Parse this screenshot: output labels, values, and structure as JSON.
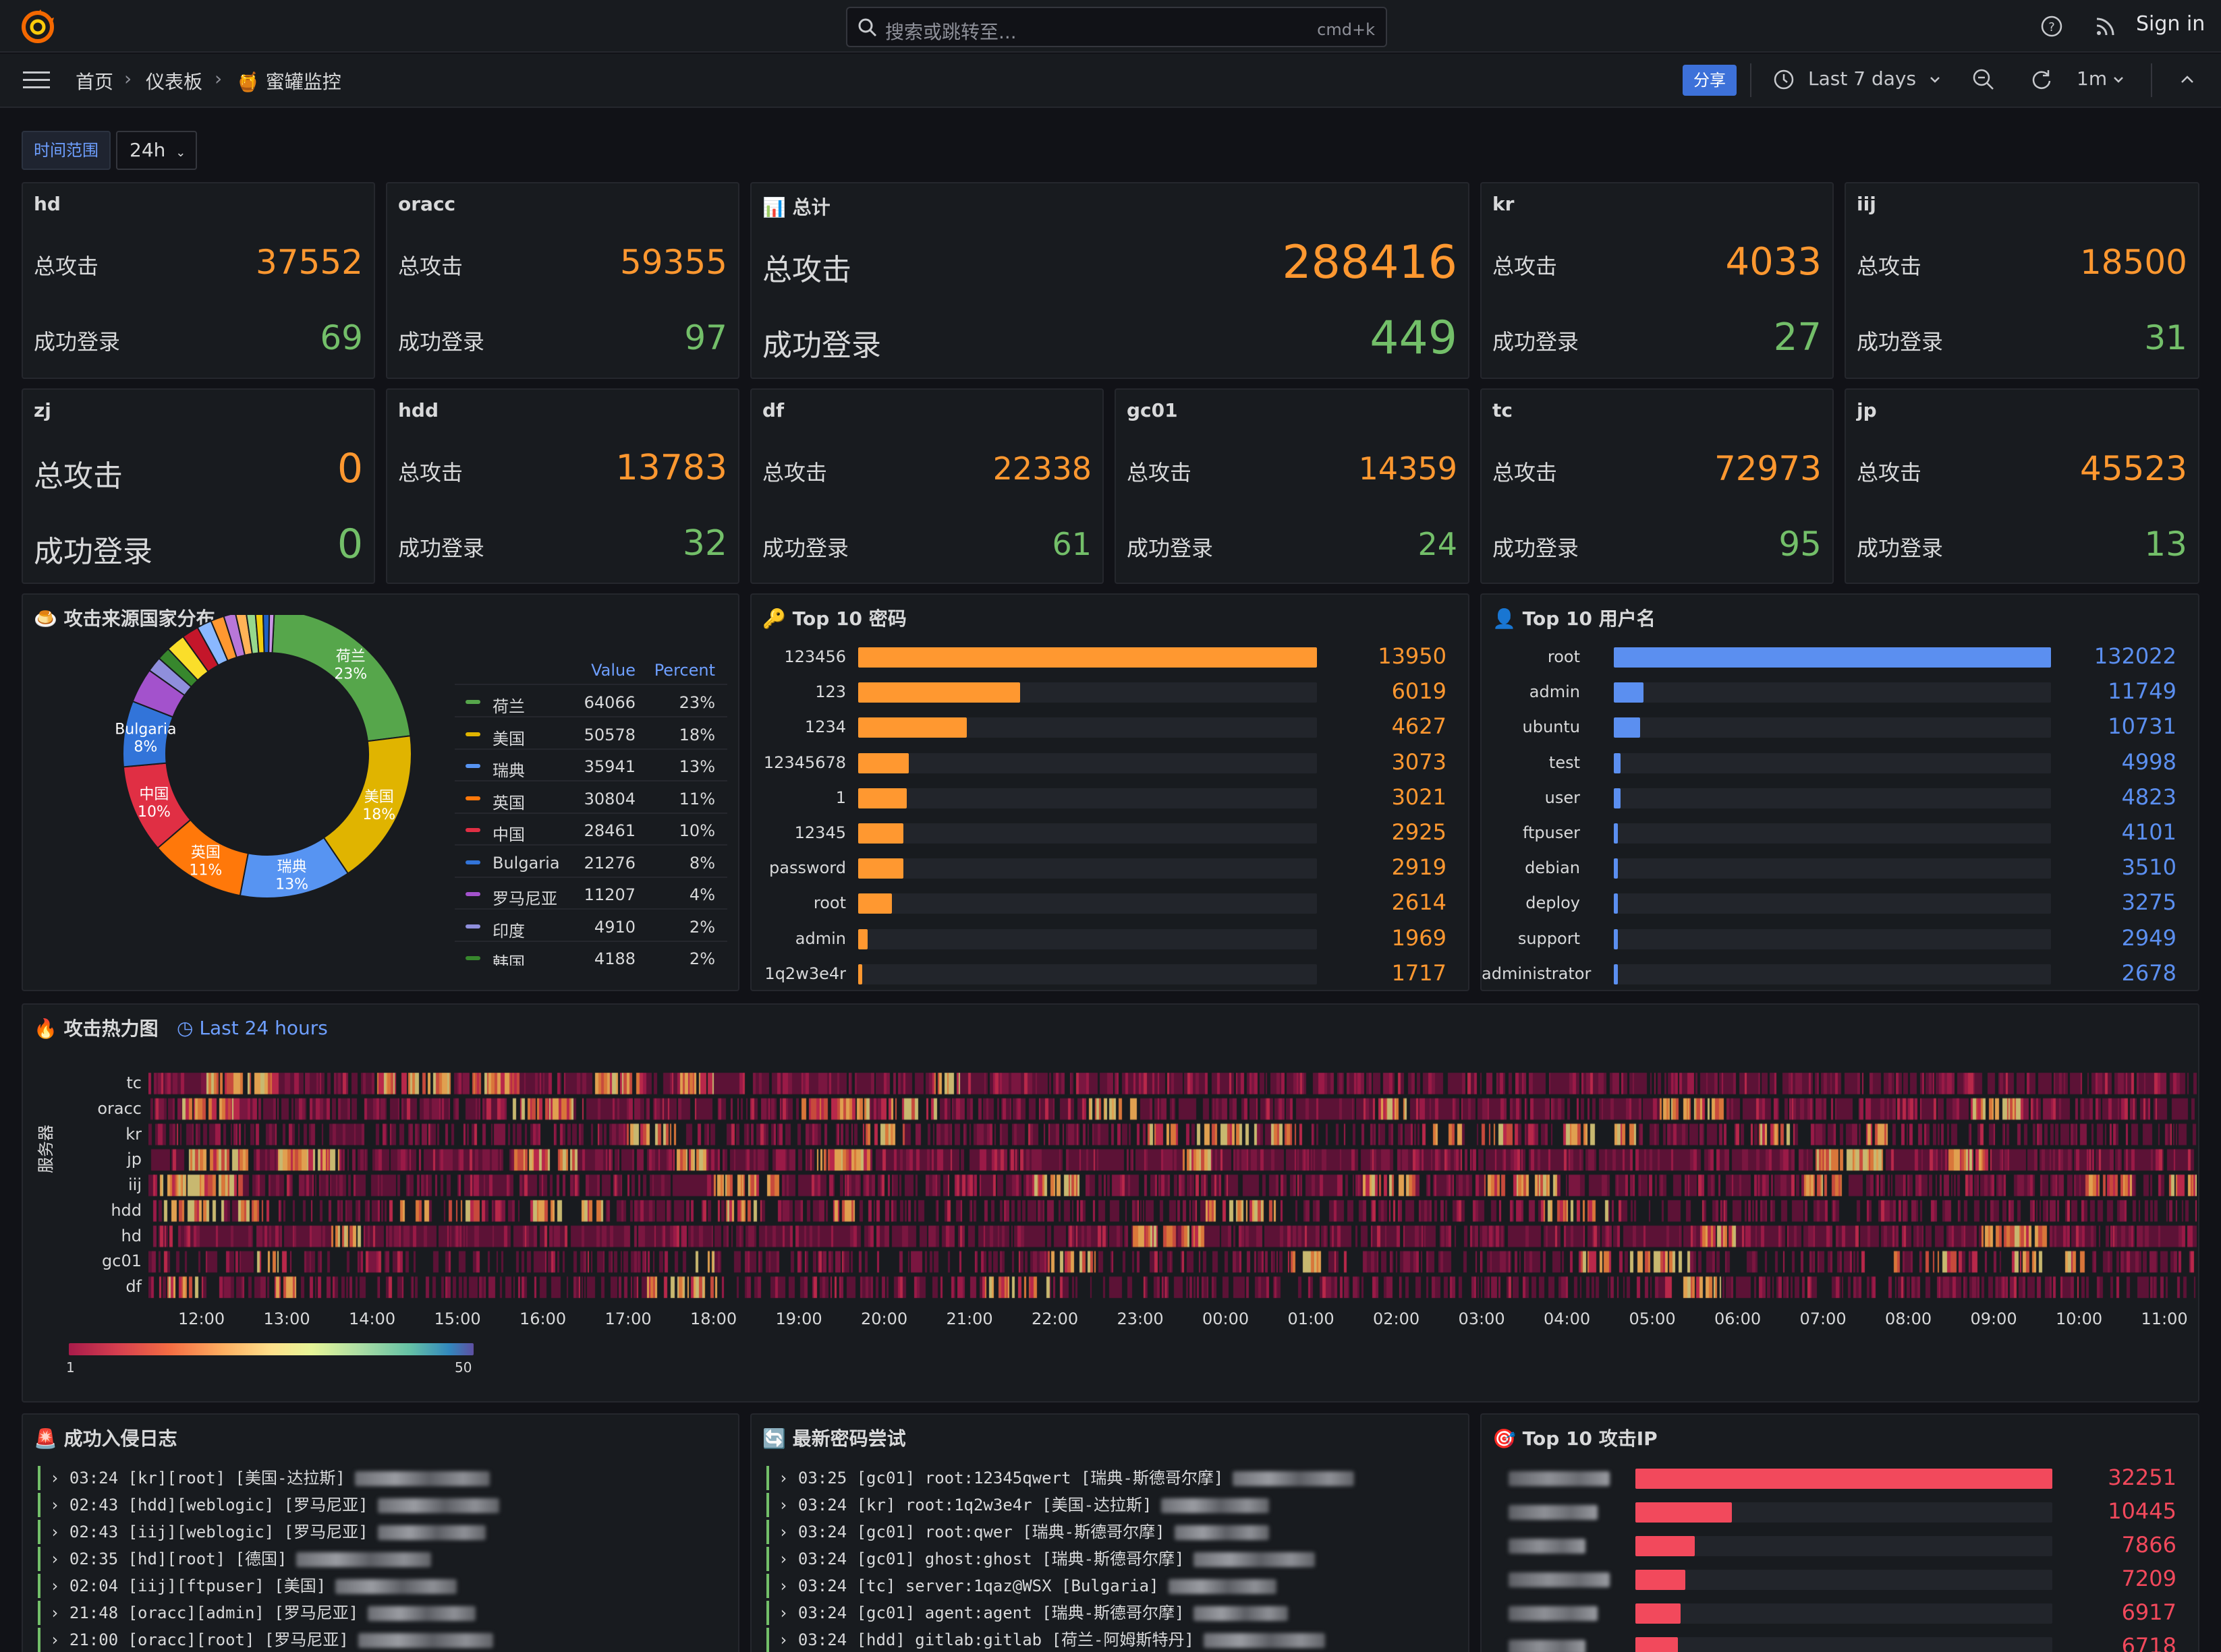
{
  "search": {
    "placeholder": "搜索或跳转至...",
    "shortcut": "cmd+k"
  },
  "header": {
    "sign_in": "Sign in"
  },
  "breadcrumb": {
    "home": "首页",
    "dashboards": "仪表板",
    "current": "🍯 蜜罐监控"
  },
  "nav": {
    "share": "分享",
    "time_range": "Last 7 days",
    "refresh_interval": "1m"
  },
  "filters": {
    "label": "时间范围",
    "value": "24h"
  },
  "stats_labels": {
    "attacks": "总攻击",
    "logins": "成功登录"
  },
  "stat_panels": [
    {
      "name": "hd",
      "attacks": "37552",
      "logins": "69"
    },
    {
      "name": "oracc",
      "attacks": "59355",
      "logins": "97"
    },
    {
      "name": "📊 总计",
      "attacks": "288416",
      "logins": "449"
    },
    {
      "name": "kr",
      "attacks": "4033",
      "logins": "27"
    },
    {
      "name": "iij",
      "attacks": "18500",
      "logins": "31"
    },
    {
      "name": "zj",
      "attacks": "0",
      "logins": "0"
    },
    {
      "name": "hdd",
      "attacks": "13783",
      "logins": "32"
    },
    {
      "name": "df",
      "attacks": "22338",
      "logins": "61"
    },
    {
      "name": "gc01",
      "attacks": "14359",
      "logins": "24"
    },
    {
      "name": "tc",
      "attacks": "72973",
      "logins": "95"
    },
    {
      "name": "jp",
      "attacks": "45523",
      "logins": "13"
    }
  ],
  "country_panel": {
    "title": "🍮 攻击来源国家分布",
    "col_value": "Value",
    "col_percent": "Percent",
    "rows": [
      {
        "name": "荷兰",
        "value": "64066",
        "percent": "23%",
        "color": "#56a64b"
      },
      {
        "name": "美国",
        "value": "50578",
        "percent": "18%",
        "color": "#e0b400"
      },
      {
        "name": "瑞典",
        "value": "35941",
        "percent": "13%",
        "color": "#5794f2"
      },
      {
        "name": "英国",
        "value": "30804",
        "percent": "11%",
        "color": "#ff780a"
      },
      {
        "name": "中国",
        "value": "28461",
        "percent": "10%",
        "color": "#e02f44"
      },
      {
        "name": "Bulgaria",
        "value": "21276",
        "percent": "8%",
        "color": "#3274d9"
      },
      {
        "name": "罗马尼亚",
        "value": "11207",
        "percent": "4%",
        "color": "#a352cc"
      },
      {
        "name": "印度",
        "value": "4910",
        "percent": "2%",
        "color": "#8f8fdc"
      },
      {
        "name": "韩国",
        "value": "4188",
        "percent": "2%",
        "color": "#37872d"
      }
    ],
    "pie_labels": [
      {
        "name": "荷兰",
        "pct": "23%"
      },
      {
        "name": "美国",
        "pct": "18%"
      },
      {
        "name": "瑞典",
        "pct": "13%"
      },
      {
        "name": "英国",
        "pct": "11%"
      },
      {
        "name": "中国",
        "pct": "10%"
      },
      {
        "name": "Bulgaria",
        "pct": "8%"
      }
    ]
  },
  "password_panel": {
    "title": "🔑 Top 10 密码",
    "items": [
      {
        "label": "123456",
        "value": "13950",
        "frac": 1.0
      },
      {
        "label": "123",
        "value": "6019",
        "frac": 0.3535
      },
      {
        "label": "1234",
        "value": "4627",
        "frac": 0.2373
      },
      {
        "label": "12345678",
        "value": "3073",
        "frac": 0.1108
      },
      {
        "label": "1",
        "value": "3021",
        "frac": 0.1066
      },
      {
        "label": "12345",
        "value": "2925",
        "frac": 0.0988
      },
      {
        "label": "password",
        "value": "2919",
        "frac": 0.0983
      },
      {
        "label": "root",
        "value": "2614",
        "frac": 0.0735
      },
      {
        "label": "admin",
        "value": "1969",
        "frac": 0.021
      },
      {
        "label": "1q2w3e4r",
        "value": "1717",
        "frac": 0.005
      }
    ]
  },
  "username_panel": {
    "title": "👤 Top 10 用户名",
    "items": [
      {
        "label": "root",
        "value": "132022",
        "frac": 1.0
      },
      {
        "label": "admin",
        "value": "11749",
        "frac": 0.068
      },
      {
        "label": "ubuntu",
        "value": "10731",
        "frac": 0.06
      },
      {
        "label": "test",
        "value": "4998",
        "frac": 0.016
      },
      {
        "label": "user",
        "value": "4823",
        "frac": 0.0147
      },
      {
        "label": "ftpuser",
        "value": "4101",
        "frac": 0.0091
      },
      {
        "label": "debian",
        "value": "3510",
        "frac": 0.0045
      },
      {
        "label": "deploy",
        "value": "3275",
        "frac": 0.0027
      },
      {
        "label": "support",
        "value": "2949",
        "frac": 0.002
      },
      {
        "label": "administrator",
        "value": "2678",
        "frac": 0.0015
      }
    ]
  },
  "heatmap_panel": {
    "title": "🔥 攻击热力图",
    "time_badge": "Last 24 hours",
    "ylabel": "服务器",
    "rows": [
      "tc",
      "oracc",
      "kr",
      "jp",
      "iij",
      "hdd",
      "hd",
      "gc01",
      "df"
    ],
    "x_ticks": [
      "12:00",
      "13:00",
      "14:00",
      "15:00",
      "16:00",
      "17:00",
      "18:00",
      "19:00",
      "20:00",
      "21:00",
      "22:00",
      "23:00",
      "00:00",
      "01:00",
      "02:00",
      "03:00",
      "04:00",
      "05:00",
      "06:00",
      "07:00",
      "08:00",
      "09:00",
      "10:00",
      "11:00"
    ],
    "scale_min": "1",
    "scale_max": "50"
  },
  "intrusion_panel": {
    "title": "🚨 成功入侵日志",
    "lines": [
      "› 03:24 [kr][root] [美国-达拉斯]",
      "› 02:43 [hdd][weblogic] [罗马尼亚]",
      "› 02:43 [iij][weblogic] [罗马尼亚]",
      "› 02:35 [hd][root] [德国]",
      "› 02:04 [iij][ftpuser] [美国]",
      "› 21:48 [oracc][admin] [罗马尼亚]",
      "› 21:00 [oracc][root] [罗马尼亚]"
    ]
  },
  "password_attempts_panel": {
    "title": "🔄 最新密码尝试",
    "lines": [
      "› 03:25 [gc01] root:12345qwert [瑞典-斯德哥尔摩]",
      "› 03:24 [kr] root:1q2w3e4r [美国-达拉斯]",
      "› 03:24 [gc01] root:qwer [瑞典-斯德哥尔摩]",
      "› 03:24 [gc01] ghost:ghost [瑞典-斯德哥尔摩]",
      "› 03:24 [tc] server:1qaz@WSX [Bulgaria]",
      "› 03:24 [gc01] agent:agent [瑞典-斯德哥尔摩]",
      "› 03:24 [hdd] gitlab:gitlab [荷兰-阿姆斯特丹]"
    ]
  },
  "ip_panel": {
    "title": "🎯 Top 10 攻击IP",
    "items": [
      {
        "value": "32251",
        "frac": 1.0
      },
      {
        "value": "10445",
        "frac": 0.232
      },
      {
        "value": "7866",
        "frac": 0.142
      },
      {
        "value": "7209",
        "frac": 0.119
      },
      {
        "value": "6917",
        "frac": 0.109
      },
      {
        "value": "6718",
        "frac": 0.102
      }
    ]
  },
  "colors": {
    "orange": "#ff9830",
    "green": "#73bf69",
    "blue": "#5b8ff0",
    "red": "#f2495c",
    "share": "#3d71d9"
  }
}
